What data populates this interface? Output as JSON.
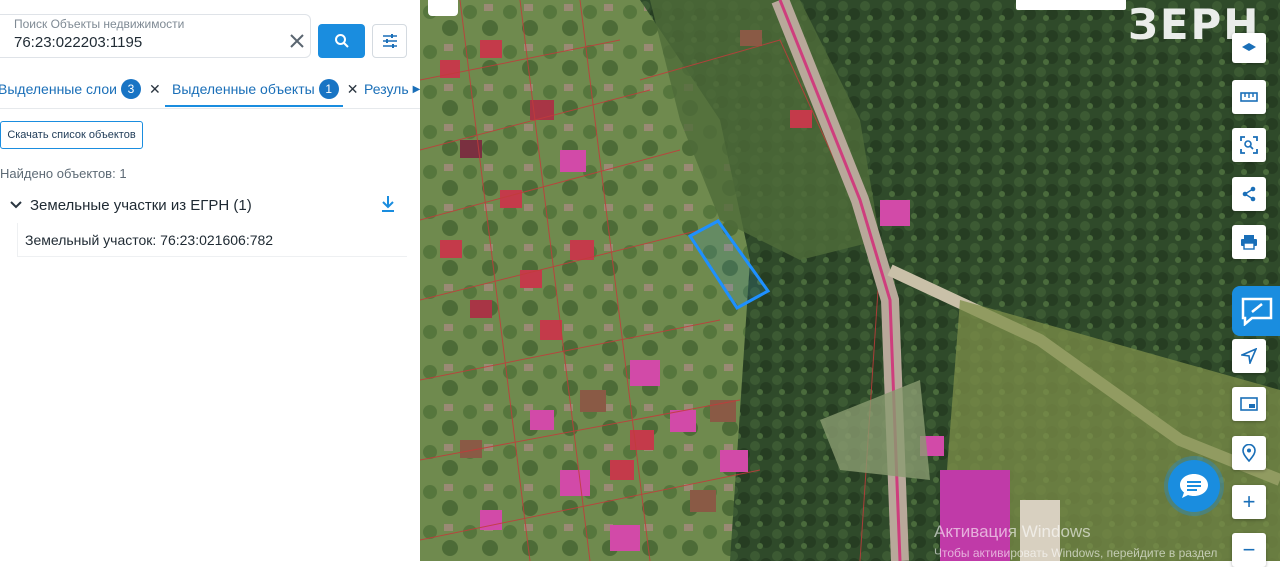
{
  "search": {
    "label": "Поиск Объекты недвижимости",
    "value": "76:23:022203:1195"
  },
  "tabs": [
    {
      "label": "Выделенные слои",
      "badge": "3"
    },
    {
      "label": "Выделенные объекты",
      "badge": "1"
    },
    {
      "label": "Резуль"
    }
  ],
  "toolbar": {
    "download_list": "Скачать список объектов"
  },
  "results": {
    "found": "Найдено объектов: 1",
    "group_title": "Земельные участки из ЕГРН (1)",
    "item": "Земельный участок: 76:23:021606:782"
  },
  "map": {
    "logo": "ЗЕРН",
    "watermark_title": "Активация Windows",
    "watermark_sub": "Чтобы активировать Windows, перейдите в раздел",
    "zoom_in": "+",
    "zoom_out": "−"
  },
  "icons": [
    "search-icon",
    "close-icon",
    "filter-icon",
    "chevron-down-icon",
    "download-icon",
    "layers-icon",
    "ruler-icon",
    "select-area-icon",
    "share-icon",
    "print-icon",
    "feedback-icon",
    "navigate-icon",
    "minimap-icon",
    "location-icon",
    "chat-icon"
  ],
  "colors": {
    "accent": "#1a8ddf",
    "badge": "#1874c4",
    "parcel_highlight": "#1e90ff"
  }
}
